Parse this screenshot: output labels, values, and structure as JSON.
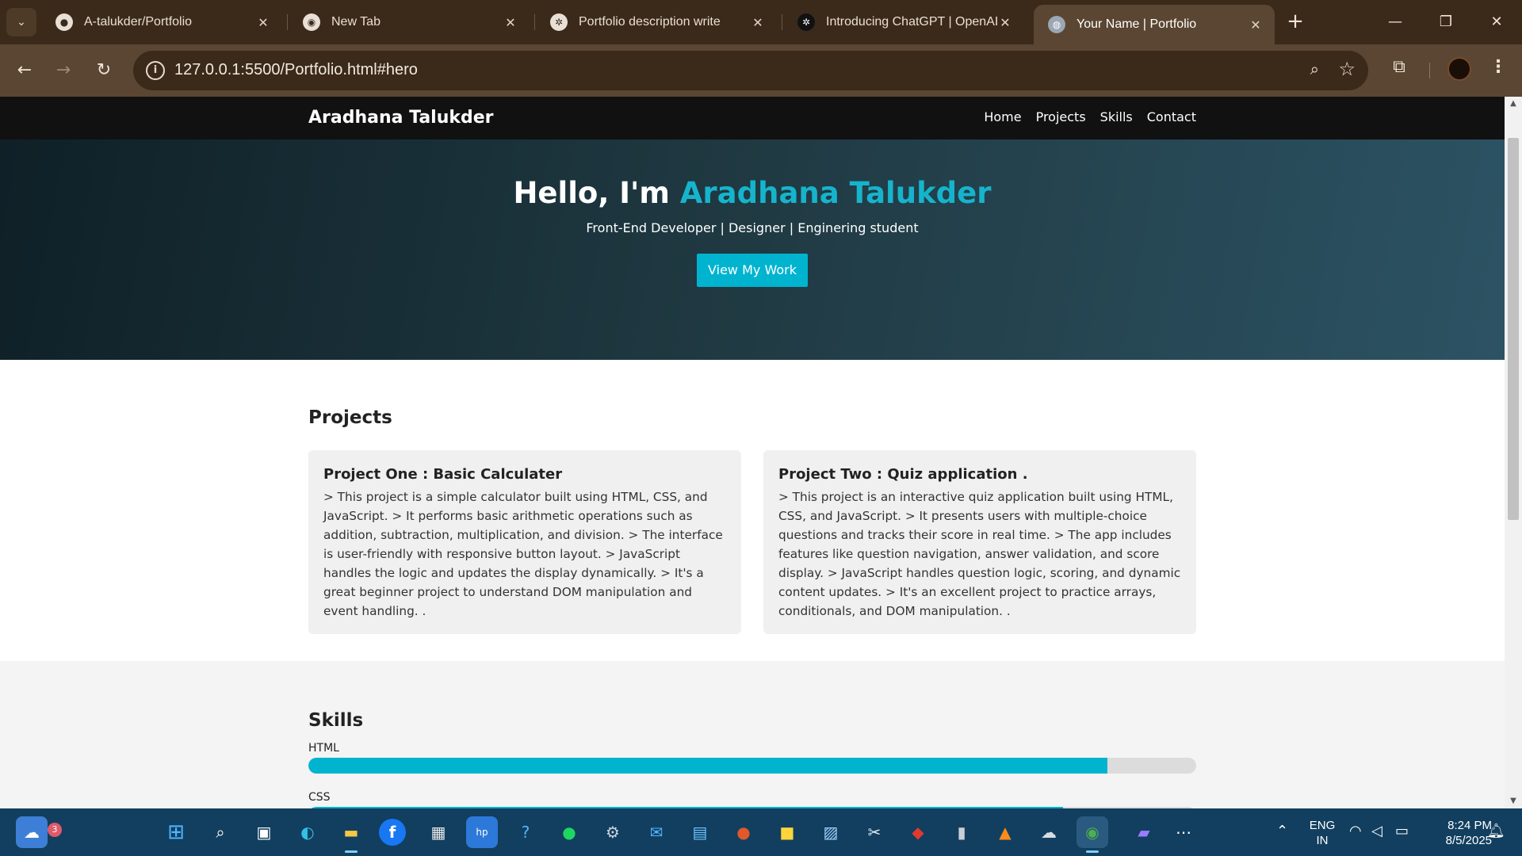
{
  "browser": {
    "tabs": [
      {
        "title": "A-talukder/Portfolio",
        "favicon": "github-icon",
        "active": false
      },
      {
        "title": "New Tab",
        "favicon": "chrome-icon",
        "active": false
      },
      {
        "title": "Portfolio description write",
        "favicon": "openai-icon",
        "active": false
      },
      {
        "title": "Introducing ChatGPT | OpenAI",
        "favicon": "openai-icon",
        "active": false
      },
      {
        "title": "Your Name | Portfolio",
        "favicon": "globe-icon",
        "active": true
      }
    ],
    "url": "127.0.0.1:5500/Portfolio.html#hero"
  },
  "site": {
    "logo": "Aradhana Talukder",
    "nav": [
      "Home",
      "Projects",
      "Skills",
      "Contact"
    ],
    "hero": {
      "greeting": "Hello, I'm ",
      "name": "Aradhana Talukder",
      "subtitle": "Front-End Developer | Designer | Enginering student",
      "cta": "View My Work"
    },
    "projects": {
      "title": "Projects",
      "items": [
        {
          "title": "Project One : Basic Calculater",
          "description": "> This project is a simple calculator built using HTML, CSS, and JavaScript. > It performs basic arithmetic operations such as addition, subtraction, multiplication, and division. > The interface is user-friendly with responsive button layout. > JavaScript handles the logic and updates the display dynamically. > It's a great beginner project to understand DOM manipulation and event handling. ."
        },
        {
          "title": "Project Two : Quiz application .",
          "description": "> This project is an interactive quiz application built using HTML, CSS, and JavaScript. > It presents users with multiple-choice questions and tracks their score in real time. > The app includes features like question navigation, answer validation, and score display. > JavaScript handles question logic, scoring, and dynamic content updates. > It's an excellent project to practice arrays, conditionals, and DOM manipulation. ."
        }
      ]
    },
    "skills": {
      "title": "Skills",
      "items": [
        {
          "name": "HTML",
          "level": 0.9
        },
        {
          "name": "CSS",
          "level": 0.85
        }
      ]
    }
  },
  "colors": {
    "accent": "#00b4d0",
    "nav_bg": "#111111",
    "hero_gradient": [
      "#0f2027",
      "#203a43",
      "#2c5364"
    ],
    "tab_strip": "#3b2a1a",
    "taskbar": "#123f5f"
  },
  "taskbar": {
    "weather_badge": "3",
    "language": "ENG",
    "region": "IN",
    "time": "8:24 PM",
    "date": "8/5/2025",
    "apps": [
      "widgets-icon",
      "start-icon",
      "search-icon",
      "task-view-icon",
      "edge-icon",
      "file-explorer-icon",
      "facebook-icon",
      "store-icon",
      "myhp-icon",
      "help-icon",
      "spotify-icon",
      "settings-icon",
      "mail-icon",
      "notepad-icon",
      "powerpoint-icon",
      "sticky-notes-icon",
      "photos-icon",
      "snipping-tool-icon",
      "acrobat-icon",
      "recorder-icon",
      "vlc-icon",
      "cloud-drive-icon",
      "chrome-icon",
      "clipchamp-icon",
      "more-apps-icon"
    ]
  }
}
